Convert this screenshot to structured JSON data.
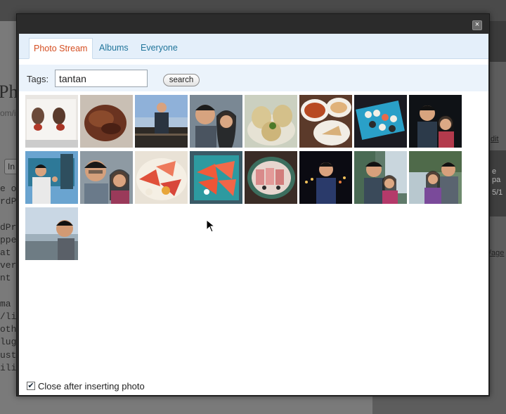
{
  "background": {
    "title_fragment": "Ph",
    "path_fragment": "om/i",
    "tab_fragment": "In",
    "text_lines": [
      "e o",
      "rdP",
      "",
      "dPr",
      "ppe",
      "at I",
      "ver",
      "nt c",
      "",
      "ma",
      "/li>",
      "oth",
      "lugi",
      "ust",
      "ility"
    ],
    "right_edit": "dit",
    "right_pa": "e pa",
    "right_date": "5/1",
    "right_page": "/age"
  },
  "dialog": {
    "close_glyph": "×",
    "tabs": [
      {
        "label": "Photo Stream",
        "active": true
      },
      {
        "label": "Albums",
        "active": false
      },
      {
        "label": "Everyone",
        "active": false
      }
    ],
    "search": {
      "label": "Tags:",
      "value": "tantan",
      "button_label": "search"
    },
    "photos": [
      "scallops on white plate",
      "roasted meat",
      "man at waterfront",
      "couple selfie",
      "dumplings",
      "soup and plated food",
      "sushi platter",
      "couple at night",
      "man at amusement park",
      "couple indoors",
      "sashimi plate",
      "salmon sashimi on teal plate",
      "seared tuna plate",
      "man at night",
      "couple by waterfall",
      "couple by waterfall 2",
      "man at beach"
    ],
    "close_after_insert": {
      "checked": true,
      "label": "Close after inserting photo"
    }
  }
}
